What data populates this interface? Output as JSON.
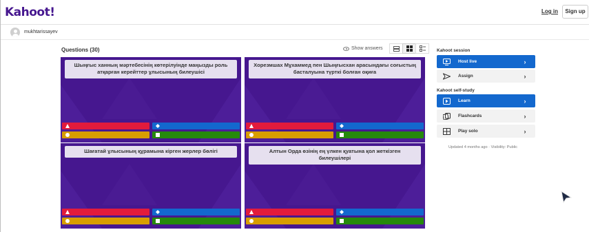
{
  "brand": {
    "logo_text": "Kahoot!",
    "accent": "#46178f"
  },
  "header": {
    "login_label": "Log in",
    "signup_label": "Sign up"
  },
  "user": {
    "name": "mukhtarissayev"
  },
  "questions": {
    "title": "Questions (30)",
    "show_answers_label": "Show answers",
    "view_modes": [
      "list-view-icon",
      "grid-view-icon",
      "detail-view-icon"
    ],
    "active_view": "grid-view-icon",
    "items": [
      {
        "text": "Шыңғыс ханның мәртебесінің көтерілуінде маңызды роль атқарған керейттер ұлысының билеушісі"
      },
      {
        "text": "Хорезмшах Мұхаммед пен Шыңғысхан арасындағы соғыстың басталуына түрткі болған оқиға"
      },
      {
        "text": "Шағатай ұлысының құрамына кірген жерлер бөлігі"
      },
      {
        "text": "Алтын Орда өзінің ең үлкен қуатына қол жеткізген билеушілері"
      }
    ],
    "answer_colors": {
      "red": "#e21b3c",
      "blue": "#1368ce",
      "yellow": "#d89e00",
      "green": "#26890c"
    }
  },
  "session": {
    "title": "Kahoot session",
    "buttons": [
      {
        "label": "Host live",
        "icon": "screen-play-icon",
        "style": "primary"
      },
      {
        "label": "Assign",
        "icon": "send-icon",
        "style": "secondary"
      }
    ]
  },
  "self_study": {
    "title": "Kahoot self-study",
    "buttons": [
      {
        "label": "Learn",
        "icon": "learn-play-icon",
        "style": "primary"
      },
      {
        "label": "Flashcards",
        "icon": "flashcards-icon",
        "style": "secondary"
      },
      {
        "label": "Play solo",
        "icon": "grid-game-icon",
        "style": "secondary"
      }
    ]
  },
  "meta": {
    "updated_text": "Updated 4 months ago · Visibility: Public"
  }
}
